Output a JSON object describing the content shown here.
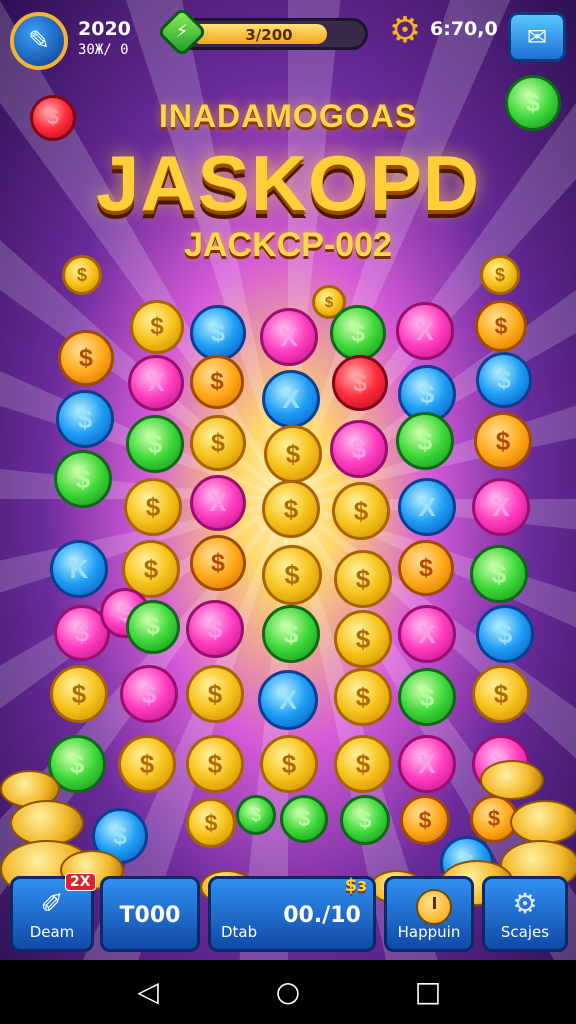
{
  "hud": {
    "level_main": "2020",
    "level_sub": "30Ж/ 0",
    "xp_text": "3/200",
    "xp_fraction": 0.85,
    "coins": "6:70,0",
    "icons": {
      "avatar": "wrench-icon",
      "gem": "gem-icon",
      "gear": "gear-icon",
      "menu": "menu-icon"
    }
  },
  "titles": {
    "top": "INADAMOGOAS",
    "main": "JASKOPD",
    "sub": "JACKCP-002"
  },
  "bottom_bar": {
    "buttons": [
      {
        "label": "Deam",
        "badge": "2X",
        "icon": "brush-icon"
      },
      {
        "value": "T000"
      },
      {
        "value": "00./10",
        "label": "Dtab",
        "tag": "$ɜ"
      },
      {
        "label": "Happuin",
        "icon": "clock-icon"
      },
      {
        "label": "Scajes",
        "icon": "gear-icon"
      }
    ]
  },
  "nav": {
    "back": "◁",
    "home": "○",
    "recent": "□"
  },
  "colors": {
    "accent_gold": "#ffcf3a",
    "button_blue": "#1f6ed6",
    "background_purple": "#2d0f52"
  }
}
